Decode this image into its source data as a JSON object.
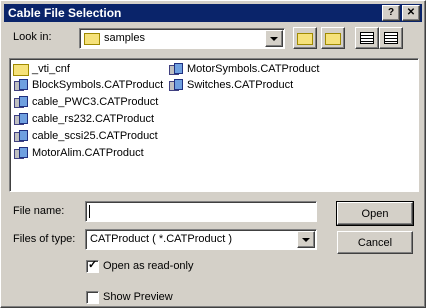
{
  "window": {
    "title": "Cable File Selection",
    "help_glyph": "?",
    "close_glyph": "✕"
  },
  "lookin": {
    "label": "Look in:",
    "value": "samples"
  },
  "files": [
    {
      "name": "_vti_cnf",
      "type": "folder"
    },
    {
      "name": "BlockSymbols.CATProduct",
      "type": "product"
    },
    {
      "name": "cable_PWC3.CATProduct",
      "type": "product"
    },
    {
      "name": "cable_rs232.CATProduct",
      "type": "product"
    },
    {
      "name": "cable_scsi25.CATProduct",
      "type": "product"
    },
    {
      "name": "MotorAlim.CATProduct",
      "type": "product"
    },
    {
      "name": "MotorSymbols.CATProduct",
      "type": "product"
    },
    {
      "name": "Switches.CATProduct",
      "type": "product"
    }
  ],
  "filename": {
    "label": "File name:",
    "value": ""
  },
  "filetype": {
    "label": "Files of type:",
    "value": "CATProduct ( *.CATProduct )"
  },
  "open_button": "Open",
  "cancel_button": "Cancel",
  "readonly": {
    "label": "Open as read-only",
    "checked": true
  },
  "preview": {
    "label": "Show Preview",
    "checked": false
  }
}
